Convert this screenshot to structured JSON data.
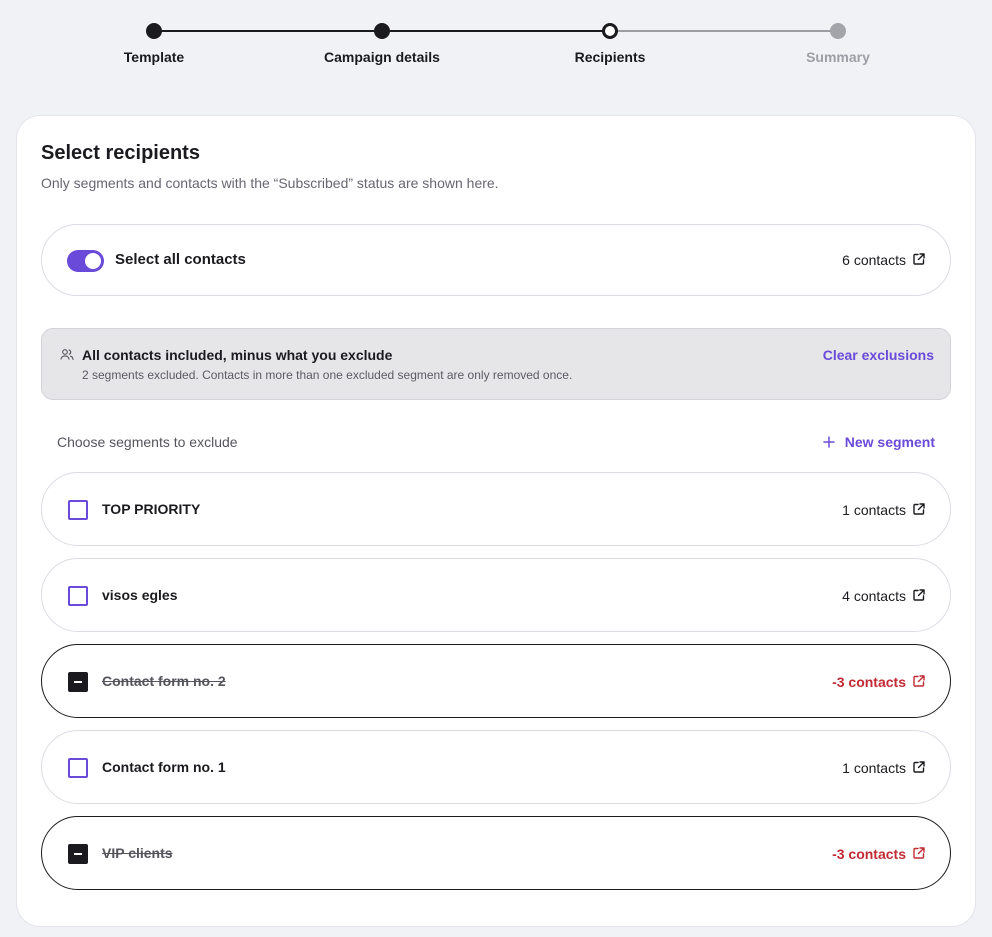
{
  "stepper": {
    "steps": [
      {
        "label": "Template",
        "state": "done"
      },
      {
        "label": "Campaign details",
        "state": "done"
      },
      {
        "label": "Recipients",
        "state": "current"
      },
      {
        "label": "Summary",
        "state": "todo"
      }
    ]
  },
  "card": {
    "title": "Select recipients",
    "subtitle": "Only segments and contacts with the “Subscribed” status are shown here."
  },
  "select_all": {
    "label": "Select all contacts",
    "enabled": true,
    "count": "6 contacts"
  },
  "banner": {
    "title": "All contacts included, minus what you exclude",
    "description": "2 segments excluded. Contacts in more than one excluded segment are only removed once.",
    "clear_label": "Clear exclusions"
  },
  "segments_header": {
    "heading": "Choose segments to exclude",
    "new_segment_label": "New segment"
  },
  "segments": [
    {
      "name": "TOP PRIORITY",
      "count": "1 contacts",
      "excluded": false
    },
    {
      "name": "visos egles",
      "count": "4 contacts",
      "excluded": false
    },
    {
      "name": "Contact form no. 2",
      "count": "-3 contacts",
      "excluded": true
    },
    {
      "name": "Contact form no. 1",
      "count": "1 contacts",
      "excluded": false
    },
    {
      "name": "VIP clients",
      "count": "-3 contacts",
      "excluded": true
    }
  ],
  "colors": {
    "accent": "#6a4bd9",
    "excluded_count": "#c22a34",
    "text": "#1b1b1f",
    "background": "#f1f2f6"
  },
  "icons": {
    "external_link": "external-link-icon",
    "people": "people-icon",
    "plus": "plus-icon"
  }
}
